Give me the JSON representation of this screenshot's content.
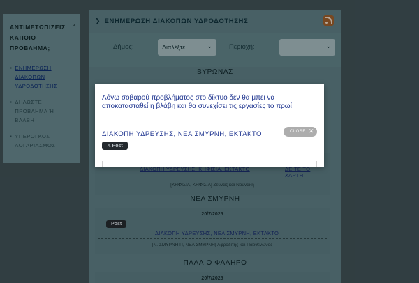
{
  "sidebar": {
    "title": "ΑΝΤΙΜΕΤΩΠΙΖΕΙΣ ΚΑΠΟΙΟ ΠΡΟΒΛΗΜΑ;",
    "collapse_glyph": "˅",
    "items": [
      {
        "label": "ΕΝΗΜΕΡΩΣΗ ΔΙΑΚΟΠΩΝ ΥΔΡΟΔΟΤΗΣΗΣ"
      },
      {
        "label": "ΔΗΛΩΣΤΕ ΠΡΟΒΛΗΜΑ Ή ΒΛΑΒΗ"
      },
      {
        "label": "ΥΠΕΡΟΓΚΟΣ ΛΟΓΑΡΙΑΣΜΟΣ"
      }
    ]
  },
  "header": {
    "title": "ΕΝΗΜΕΡΩΣΗ ΔΙΑΚΟΠΩΝ ΥΔΡΟΔΟΤΗΣΗΣ"
  },
  "filters": {
    "municipality_label": "Δήμος:",
    "municipality_value": "Διαλέξτε",
    "area_label": "Περιοχή:",
    "area_value": ""
  },
  "sections": [
    {
      "title": "ΒΥΡΩΝΑΣ"
    },
    {
      "title": "",
      "link": "ΔΙΑΚΟΠΗ ΥΔΡΕΥΣΗΣ, ΚΗΦΙΣΙΑ, ΕΚΤΑΚΤΟ",
      "more": "ΔΕΙΤΕ ΤΟ ΧΑΡΤΗ",
      "note": "[ΚΗΦΙΣΙΑ, ΚΗΦΙΣΙΑ] Ζεύνας και Νουνάκη"
    },
    {
      "title": "ΝΕΑ ΣΜΥΡΝΗ",
      "date": "20/7/2025",
      "link": "ΔΙΑΚΟΠΗ ΥΔΡΕΥΣΗΣ, ΝΕΑ ΣΜΥΡΝΗ, ΕΚΤΑΚΤΟ",
      "note": "[Ν. ΣΜΥΡΝΗ Π, ΝΕΑ ΣΜΥΡΝΗ] Αφροδίτης και Παρθενώνος"
    },
    {
      "title": "ΠΑΛΑΙΟ ΦΑΛΗΡΟ",
      "date": "20/7/2025"
    }
  ],
  "tweet_label": "Post",
  "modal": {
    "message": "Λόγω σοβαρού προβλήματος στο δίκτυο δεν θα μπει να αποκατασταθεί η βλάβη και θα συνεχίσει τις εργασίες το πρωί",
    "link": "ΔΙΑΚΟΠΗ ΥΔΡΕΥΣΗΣ, ΝΕΑ ΣΜΥΡΝΗ, ΕΚΤΑΚΤΟ",
    "close_label": "CLOSE",
    "close_glyph": "✕"
  },
  "colors": {
    "accent_link": "#1f3590",
    "rss": "#9a5d2b"
  }
}
